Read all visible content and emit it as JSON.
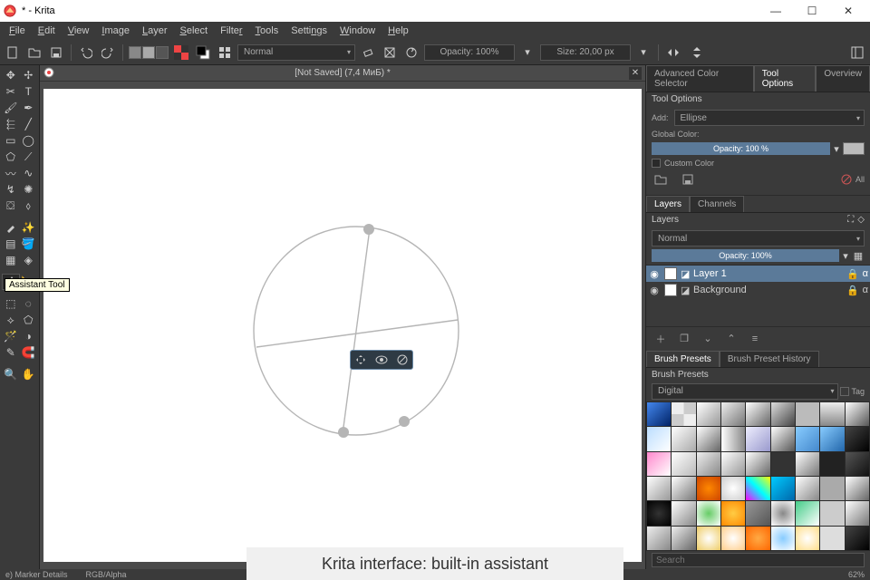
{
  "titlebar": {
    "title": "* - Krita"
  },
  "menubar": [
    "File",
    "Edit",
    "View",
    "Image",
    "Layer",
    "Select",
    "Filter",
    "Tools",
    "Settings",
    "Window",
    "Help"
  ],
  "toolbar": {
    "blend_mode": "Normal",
    "opacity": "Opacity: 100%",
    "size": "Size: 20,00 px"
  },
  "doc_tab": {
    "label": "[Not Saved] (7,4 MиБ) *"
  },
  "tooltip": "Assistant Tool",
  "right": {
    "tabs": [
      "Advanced Color Selector",
      "Tool Options",
      "Overview"
    ],
    "tool_options_title": "Tool Options",
    "add_label": "Add:",
    "add_value": "Ellipse",
    "global_color_label": "Global Color:",
    "opacity_slider": "Opacity: 100 %",
    "custom_color": "Custom Color",
    "all_label": "All",
    "layers_tabs": [
      "Layers",
      "Channels"
    ],
    "layers_title": "Layers",
    "layers_blend": "Normal",
    "layers_opacity": "Opacity:  100%",
    "layers": [
      {
        "name": "Layer 1",
        "selected": true
      },
      {
        "name": "Background",
        "selected": false
      }
    ],
    "preset_tabs": [
      "Brush Presets",
      "Brush Preset History"
    ],
    "preset_title": "Brush Presets",
    "preset_cat": "Digital",
    "tag_label": "Tag",
    "search_placeholder": "Search"
  },
  "statusbar": {
    "left": "e) Marker Details",
    "center": "RGB/Alpha",
    "zoom": "62%"
  },
  "caption": "Krita interface: built-in assistant"
}
